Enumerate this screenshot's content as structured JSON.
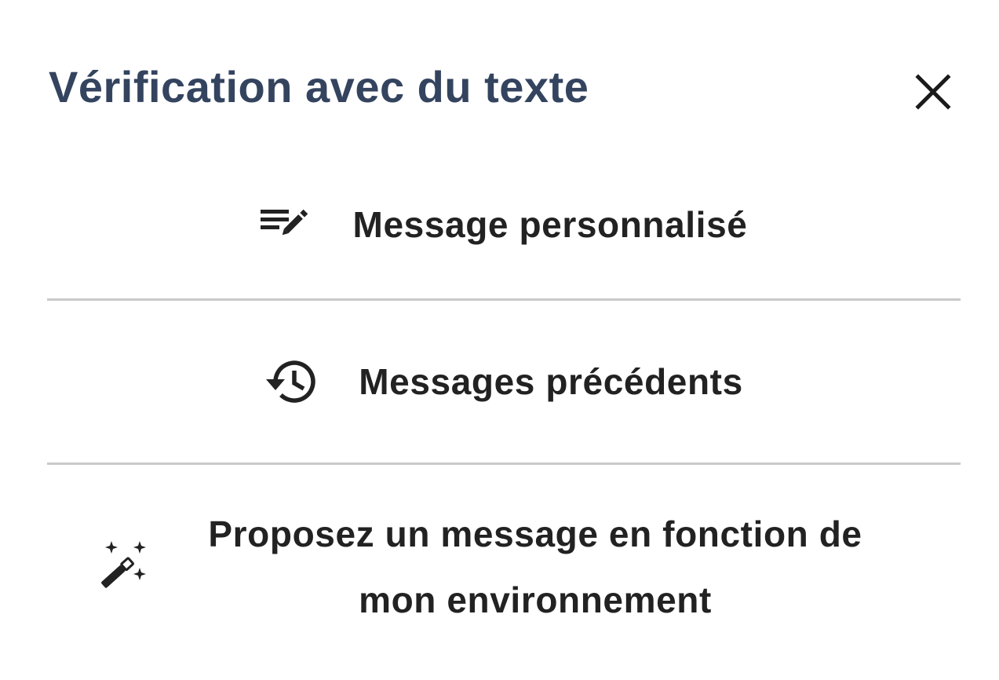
{
  "header": {
    "title": "Vérification avec du texte"
  },
  "close": {
    "icon": "close-icon"
  },
  "menu": {
    "items": [
      {
        "icon": "edit-list-icon",
        "label": "Message personnalisé"
      },
      {
        "icon": "history-icon",
        "label": "Messages précédents"
      },
      {
        "icon": "magic-wand-icon",
        "label": "Proposez un message en fonction de mon environnement"
      }
    ]
  },
  "colors": {
    "title": "#34445f",
    "text": "#222222",
    "divider": "#c9c9c9",
    "background": "#ffffff"
  }
}
